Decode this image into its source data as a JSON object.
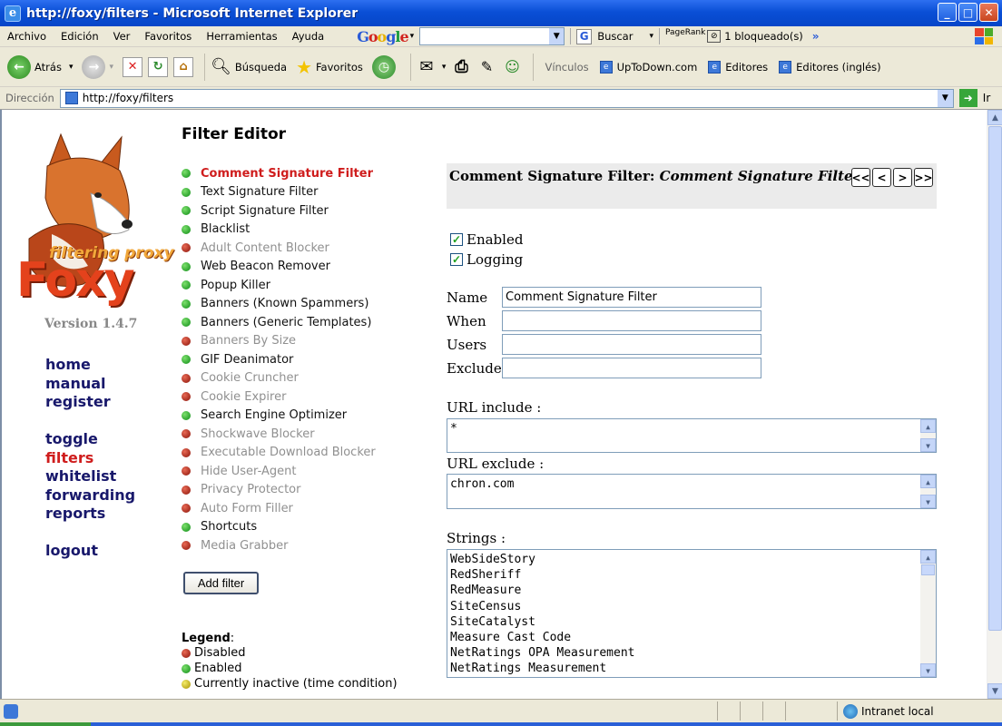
{
  "window": {
    "title": "http://foxy/filters - Microsoft Internet Explorer",
    "controls": [
      "_",
      "□",
      "✕"
    ]
  },
  "menu": [
    "Archivo",
    "Edición",
    "Ver",
    "Favoritos",
    "Herramientas",
    "Ayuda"
  ],
  "google_toolbar": {
    "logo": [
      "G",
      "o",
      "o",
      "g",
      "l",
      "e"
    ],
    "search_label": "Buscar",
    "pagerank_label": "PageRank",
    "blocked_label": "1 bloqueado(s)",
    "more": "»"
  },
  "toolbar": {
    "back": "Atrás",
    "search": "Búsqueda",
    "favorites": "Favoritos",
    "links_label": "Vínculos",
    "links": [
      "UpToDown.com",
      "Editores",
      "Editores (inglés)"
    ]
  },
  "address": {
    "label": "Dirección",
    "url": "http://foxy/filters",
    "go": "Ir"
  },
  "sidebar": {
    "logo_top": "filtering proxy",
    "logo_name": "Foxy",
    "version": "Version 1.4.7",
    "nav_group1": [
      "home",
      "manual",
      "register"
    ],
    "nav_group2": [
      "toggle",
      "filters",
      "whitelist",
      "forwarding",
      "reports"
    ],
    "nav_group3": [
      "logout"
    ],
    "current": "filters"
  },
  "main": {
    "title": "Filter Editor",
    "filters": [
      {
        "label": "Comment Signature Filter",
        "state": "enabled",
        "selected": true
      },
      {
        "label": "Text Signature Filter",
        "state": "enabled"
      },
      {
        "label": "Script Signature Filter",
        "state": "enabled"
      },
      {
        "label": "Blacklist",
        "state": "enabled"
      },
      {
        "label": "Adult Content Blocker",
        "state": "disabled"
      },
      {
        "label": "Web Beacon Remover",
        "state": "enabled"
      },
      {
        "label": "Popup Killer",
        "state": "enabled"
      },
      {
        "label": "Banners (Known Spammers)",
        "state": "enabled"
      },
      {
        "label": "Banners (Generic Templates)",
        "state": "enabled"
      },
      {
        "label": "Banners By Size",
        "state": "disabled"
      },
      {
        "label": "GIF Deanimator",
        "state": "enabled"
      },
      {
        "label": "Cookie Cruncher",
        "state": "disabled"
      },
      {
        "label": "Cookie Expirer",
        "state": "disabled"
      },
      {
        "label": "Search Engine Optimizer",
        "state": "enabled"
      },
      {
        "label": "Shockwave Blocker",
        "state": "disabled"
      },
      {
        "label": "Executable Download Blocker",
        "state": "disabled"
      },
      {
        "label": "Hide User-Agent",
        "state": "disabled"
      },
      {
        "label": "Privacy Protector",
        "state": "disabled"
      },
      {
        "label": "Auto Form Filler",
        "state": "disabled"
      },
      {
        "label": "Shortcuts",
        "state": "enabled"
      },
      {
        "label": "Media Grabber",
        "state": "disabled"
      }
    ],
    "add_filter": "Add filter",
    "legend": {
      "title": "Legend",
      "items": [
        {
          "label": "Disabled",
          "state": "disabled"
        },
        {
          "label": "Enabled",
          "state": "enabled"
        },
        {
          "label": "Currently inactive (time condition)",
          "state": "inactive"
        }
      ]
    }
  },
  "editor": {
    "heading_name": "Comment Signature Filter:",
    "heading_sub": "Comment Signature Filter",
    "nav_buttons": [
      "<<",
      "<",
      ">",
      ">>"
    ],
    "enabled_label": "Enabled",
    "enabled": true,
    "logging_label": "Logging",
    "logging": true,
    "fields": [
      {
        "label": "Name",
        "value": "Comment Signature Filter"
      },
      {
        "label": "When",
        "value": ""
      },
      {
        "label": "Users",
        "value": ""
      },
      {
        "label": "Exclude",
        "value": ""
      }
    ],
    "url_include_label": "URL include :",
    "url_include": "*",
    "url_exclude_label": "URL exclude :",
    "url_exclude": "chron.com",
    "strings_label": "Strings :",
    "strings": [
      "WebSideStory",
      "RedSheriff",
      "RedMeasure",
      "SiteCensus",
      "SiteCatalyst",
      "Measure Cast Code",
      "NetRatings OPA Measurement",
      "NetRatings Measurement"
    ]
  },
  "status": {
    "zone": "Intranet local"
  },
  "colors": {
    "enabled_dot": "#0b8a14",
    "disabled_dot": "#8a1208",
    "inactive_dot": "#a69000",
    "selected_text": "#cf1d1d",
    "nav_link": "#18186b"
  }
}
